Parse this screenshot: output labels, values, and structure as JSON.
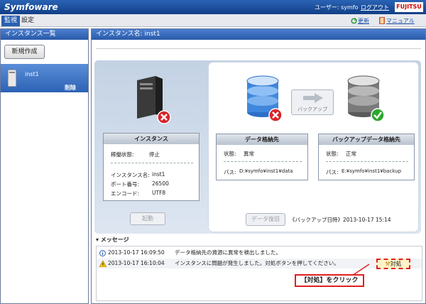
{
  "header": {
    "logo": "Symfoware",
    "user_label": "ユーザー: symfo",
    "logout": "ログアウト",
    "brand": "FUJITSU"
  },
  "tabs": {
    "kanshi": "監視",
    "settei": "設定",
    "update": "更新",
    "manual": "マニュアル"
  },
  "left": {
    "title": "インスタンス一覧",
    "new_button": "新規作成",
    "instance": {
      "name": "inst1",
      "delete": "削除"
    }
  },
  "right": {
    "title": "インスタンス名: inst1"
  },
  "instance_card": {
    "title": "インスタンス",
    "status_label": "稼働状態:",
    "status_value": "停止",
    "name_label": "インスタンス名:",
    "name_value": "inst1",
    "port_label": "ポート番号:",
    "port_value": "26500",
    "encode_label": "エンコード:",
    "encode_value": "UTF8",
    "start_button": "起動"
  },
  "backup_button": "バックアップ",
  "data_card": {
    "title": "データ格納先",
    "status_label": "状態:",
    "status_value": "異常",
    "path_label": "パス:",
    "path_value": "D:¥symfo¥inst1¥data"
  },
  "backup_card": {
    "title": "バックアップデータ格納先",
    "status_label": "状態:",
    "status_value": "正常",
    "path_label": "パス:",
    "path_value": "E:¥symfo¥inst1¥backup"
  },
  "restore": {
    "button": "データ復旧",
    "backup_time": "《バックアップ日時》2013-10-17 15:14"
  },
  "messages": {
    "title": "メッセージ",
    "rows": [
      {
        "time": "2013-10-17 16:09:50",
        "text": "データ格納先の資源に異常を検出しました。"
      },
      {
        "time": "2013-10-17 16:10:04",
        "text": "インスタンスに問題が発生しました。対処ボタンを押してください。"
      }
    ],
    "action_button": "対処"
  },
  "callout": "【対処】をクリック",
  "colors": {
    "header_blue": "#1d4f9e",
    "error_red": "#d9242a",
    "ok_green": "#2ea62e",
    "highlight_red": "#e02020"
  }
}
